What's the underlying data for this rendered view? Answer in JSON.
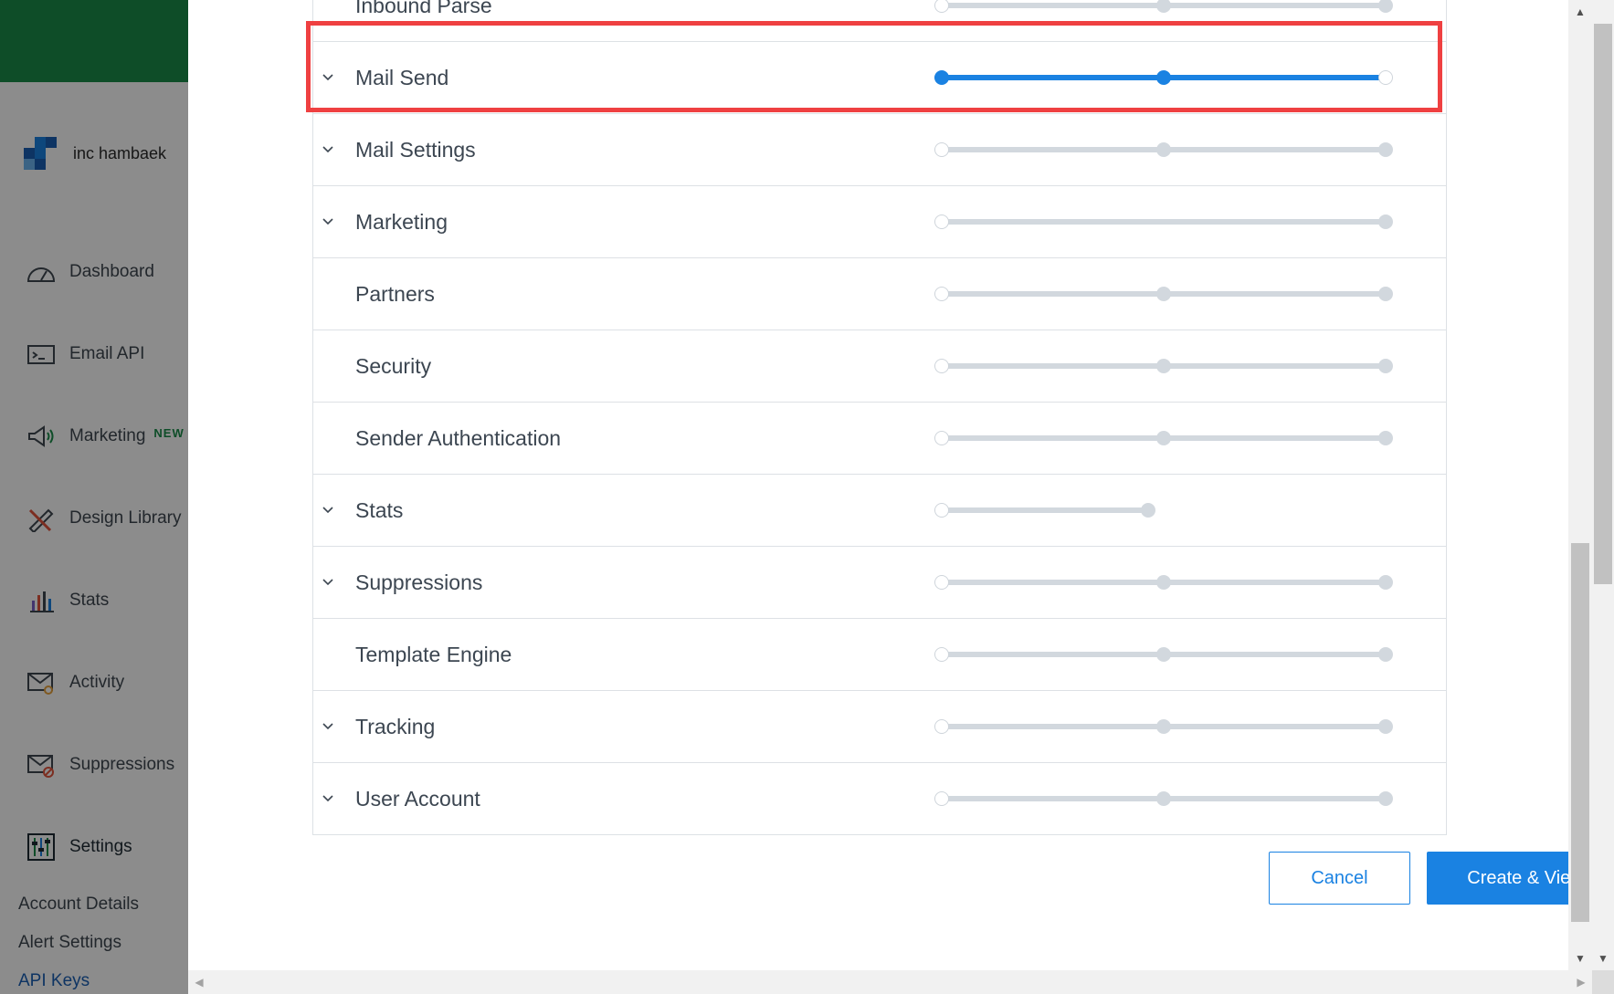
{
  "sidebar": {
    "account_name": "inc hambaek",
    "items": [
      {
        "label": "Dashboard",
        "icon": "gauge-icon"
      },
      {
        "label": "Email API",
        "icon": "terminal-icon"
      },
      {
        "label": "Marketing",
        "icon": "megaphone-icon",
        "badge": "NEW"
      },
      {
        "label": "Design Library",
        "icon": "pencil-ruler-icon"
      },
      {
        "label": "Stats",
        "icon": "bar-chart-icon"
      },
      {
        "label": "Activity",
        "icon": "envelope-search-icon"
      },
      {
        "label": "Suppressions",
        "icon": "envelope-block-icon"
      },
      {
        "label": "Settings",
        "icon": "sliders-icon"
      }
    ],
    "subitems": [
      {
        "label": "Account Details"
      },
      {
        "label": "Alert Settings"
      },
      {
        "label": "API Keys"
      }
    ]
  },
  "permissions": [
    {
      "label": "Inbound Parse",
      "expandable": false,
      "level": 0,
      "stops": 3
    },
    {
      "label": "Mail Send",
      "expandable": true,
      "level": 0.5,
      "stops": 3
    },
    {
      "label": "Mail Settings",
      "expandable": true,
      "level": 0,
      "stops": 3
    },
    {
      "label": "Marketing",
      "expandable": true,
      "level": 0,
      "stops": 2
    },
    {
      "label": "Partners",
      "expandable": false,
      "level": 0,
      "stops": 3
    },
    {
      "label": "Security",
      "expandable": false,
      "level": 0,
      "stops": 3
    },
    {
      "label": "Sender Authentication",
      "expandable": false,
      "level": 0,
      "stops": 3
    },
    {
      "label": "Stats",
      "expandable": true,
      "level": 0,
      "stops": 2,
      "short": true
    },
    {
      "label": "Suppressions",
      "expandable": true,
      "level": 0,
      "stops": 3
    },
    {
      "label": "Template Engine",
      "expandable": false,
      "level": 0,
      "stops": 3
    },
    {
      "label": "Tracking",
      "expandable": true,
      "level": 0,
      "stops": 3
    },
    {
      "label": "User Account",
      "expandable": true,
      "level": 0,
      "stops": 3
    }
  ],
  "buttons": {
    "cancel": "Cancel",
    "create": "Create & View"
  },
  "colors": {
    "accent": "#1a82e2",
    "brand": "#1a8c4a",
    "highlight": "#ef4041"
  }
}
